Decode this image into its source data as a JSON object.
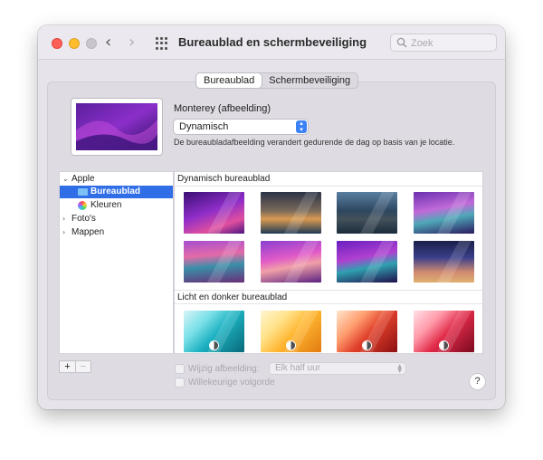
{
  "window": {
    "title": "Bureaublad en schermbeveiliging",
    "search_placeholder": "Zoek",
    "back_glyph": "‹",
    "forward_glyph": "›"
  },
  "tabs": [
    {
      "label": "Bureaublad",
      "active": true
    },
    {
      "label": "Schermbeveiliging",
      "active": false
    }
  ],
  "current": {
    "name": "Monterey (afbeelding)",
    "mode": "Dynamisch",
    "description": "De bureaubladafbeelding verandert gedurende de dag op basis van je locatie."
  },
  "sidebar": {
    "items": [
      {
        "label": "Apple",
        "chevron": "⌄",
        "level": 0
      },
      {
        "label": "Bureaublad",
        "level": 1,
        "selected": true,
        "icon": "folder-icon"
      },
      {
        "label": "Kleuren",
        "level": 1,
        "icon": "color-wheel-icon"
      },
      {
        "label": "Foto's",
        "chevron": "›",
        "level": 0
      },
      {
        "label": "Mappen",
        "chevron": "›",
        "level": 0
      }
    ],
    "add_label": "+",
    "remove_label": "−"
  },
  "gallery": {
    "sections": [
      {
        "title": "Dynamisch bureaublad",
        "thumbs": [
          "monterey-purple",
          "catalina-coast-dusk",
          "catalina-island",
          "mojave-coast-purple",
          "big-sur-lake-day",
          "big-sur-mountains",
          "big-sur-coast-night",
          "big-sur-gradient-night"
        ]
      },
      {
        "title": "Licht en donker bureaublad",
        "thumbs": [
          "teal-waves",
          "yellow-waves",
          "orange-waves",
          "pink-red-waves"
        ]
      }
    ]
  },
  "options": {
    "change_picture_label": "Wijzig afbeelding:",
    "interval": "Elk half uur",
    "random_order_label": "Willekeurige volgorde",
    "help_label": "?"
  }
}
